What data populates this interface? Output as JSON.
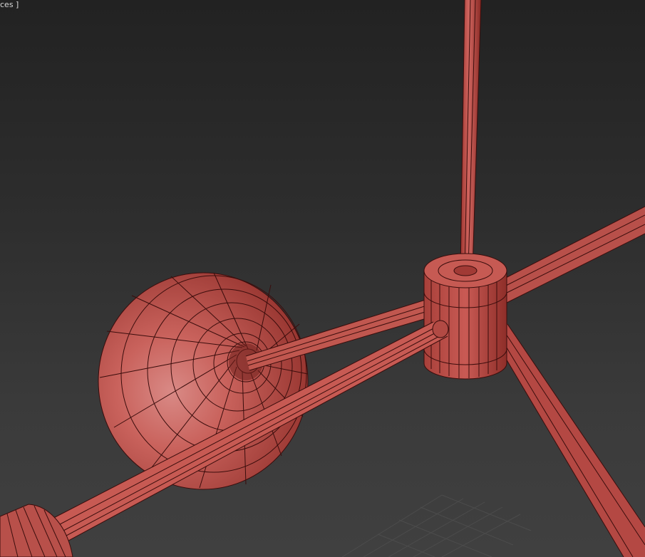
{
  "viewport": {
    "label": "ces ]",
    "background_top": "#222222",
    "background_bottom": "#404040",
    "mesh_color": "#c14a44",
    "wire_color": "#3a0d0c",
    "grid_color": "#4a4a4a"
  },
  "scene": {
    "objects": [
      {
        "name": "hub-cylinder",
        "kind": "cylinder"
      },
      {
        "name": "vertical-rod",
        "kind": "cylinder"
      },
      {
        "name": "right-arm-rod",
        "kind": "cylinder"
      },
      {
        "name": "lower-right-arm-rod",
        "kind": "cylinder"
      },
      {
        "name": "left-arm-rod",
        "kind": "cylinder"
      },
      {
        "name": "lamp-shade-sphere",
        "kind": "hemisphere"
      },
      {
        "name": "end-cap-cylinder",
        "kind": "cylinder"
      },
      {
        "name": "shade-stem-rod",
        "kind": "cylinder"
      }
    ]
  }
}
